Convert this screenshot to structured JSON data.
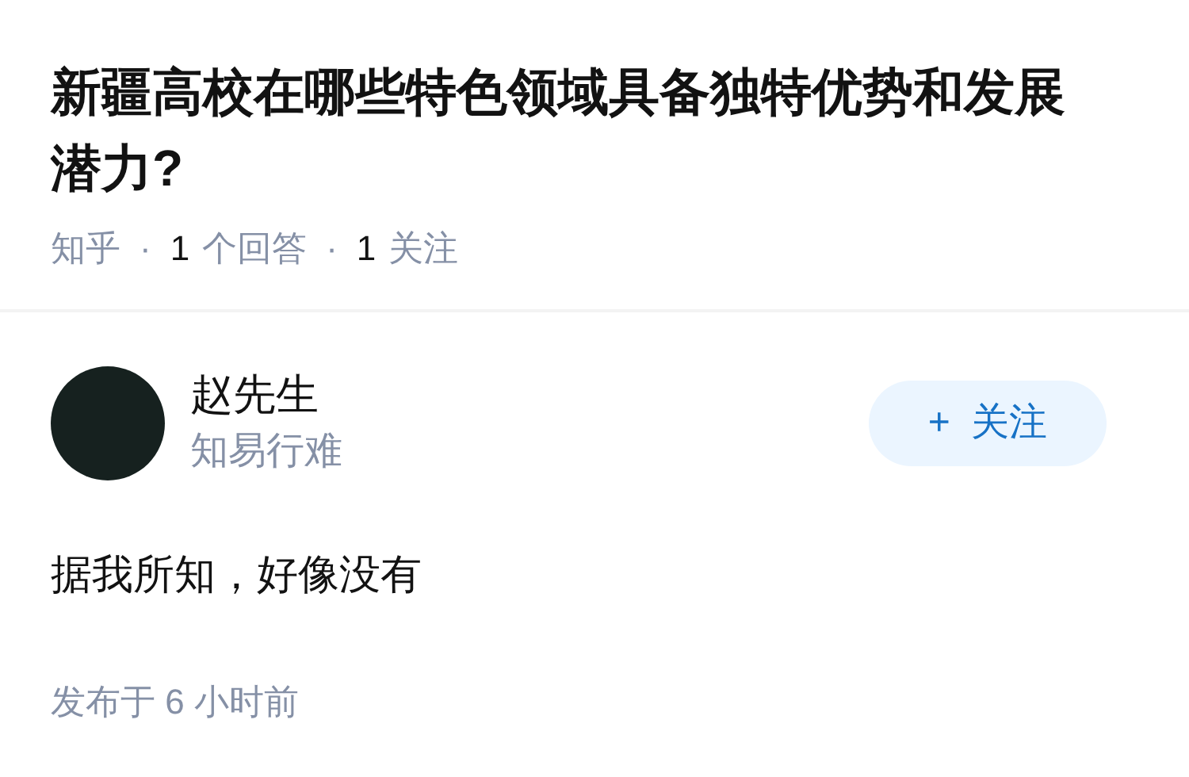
{
  "question": {
    "title": "新疆高校在哪些特色领域具备独特优势和发展潜力?",
    "meta": [
      {
        "label": "知乎"
      },
      {
        "count": "1",
        "label": "个回答"
      },
      {
        "count": "1",
        "label": "关注"
      }
    ],
    "separator": "·"
  },
  "answer": {
    "author": {
      "name": "赵先生",
      "headline": "知易行难"
    },
    "follow_button": {
      "icon": "+",
      "label": "关注"
    },
    "content": "据我所知，好像没有",
    "published": "发布于 6 小时前"
  }
}
